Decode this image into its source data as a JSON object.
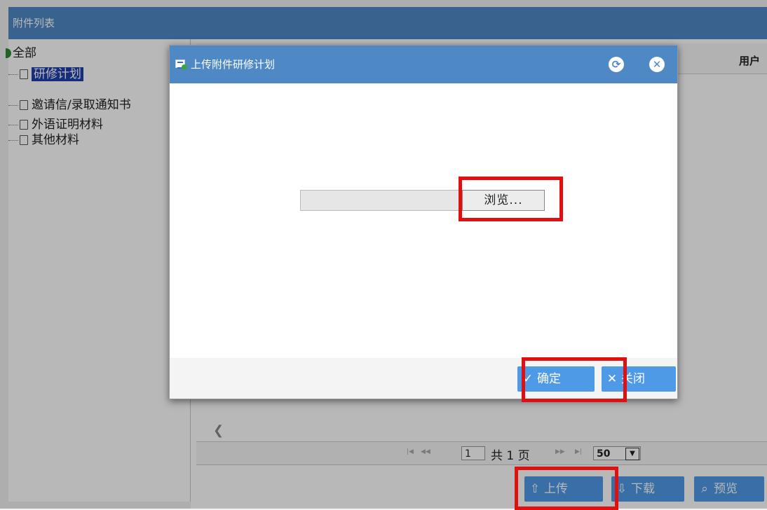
{
  "window": {
    "title": "附件列表"
  },
  "tree": {
    "root": "全部",
    "items": [
      {
        "label": "研修计划",
        "selected": true
      },
      {
        "label": "邀请信/录取通知书",
        "selected": false
      },
      {
        "label": "外语证明材料",
        "selected": false
      },
      {
        "label": "其他材料",
        "selected": false
      }
    ]
  },
  "grid": {
    "col_user": "用户"
  },
  "pager": {
    "current_page": "1",
    "total_text": "共 1 页",
    "page_size": "50"
  },
  "toolbar": {
    "upload": "上传",
    "download": "下载",
    "preview": "预览"
  },
  "dialog": {
    "title": "上传附件研修计划",
    "browse": "浏览...",
    "ok": "确定",
    "close": "关闭"
  },
  "colors": {
    "header_blue": "#4f89c5",
    "button_blue": "#4f9ae6",
    "highlight_red": "#e01010"
  }
}
